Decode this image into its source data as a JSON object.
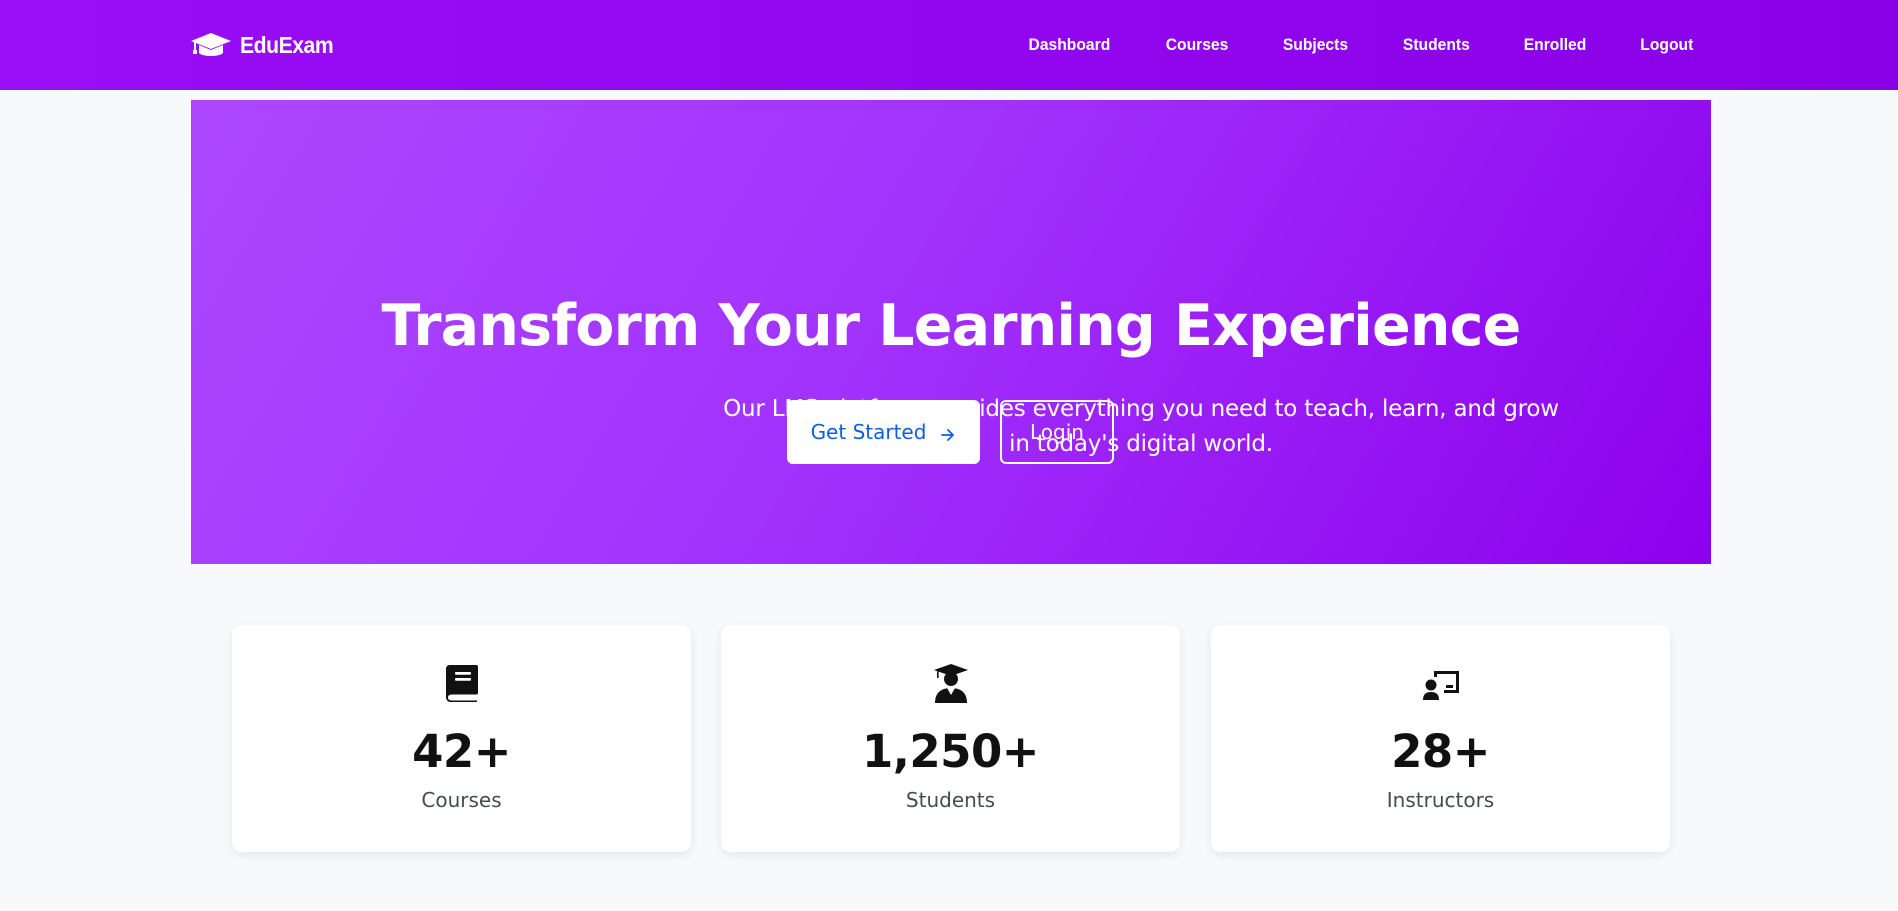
{
  "navbar": {
    "brand": "EduExam",
    "brand_icon": "graduation-cap-icon",
    "links": [
      {
        "label": "Dashboard"
      },
      {
        "label": "Courses"
      },
      {
        "label": "Subjects"
      },
      {
        "label": "Students"
      },
      {
        "label": "Enrolled"
      },
      {
        "label": "Logout"
      }
    ]
  },
  "hero": {
    "title": "Transform Your Learning Experience",
    "subtitle": "Our LMS platform provides everything you need to teach, learn, and grow in today's digital world.",
    "primary_button": {
      "label": "Get Started",
      "icon": "arrow-right-icon"
    },
    "secondary_button": {
      "label": "Login"
    }
  },
  "stats": [
    {
      "icon": "book-icon",
      "value": "42+",
      "label": "Courses"
    },
    {
      "icon": "user-graduate-icon",
      "value": "1,250+",
      "label": "Students"
    },
    {
      "icon": "chalkboard-teacher-icon",
      "value": "28+",
      "label": "Instructors"
    }
  ],
  "colors": {
    "nav_bg": "#9a0ef7",
    "hero_start": "#ac47ff",
    "hero_end": "#8d00ec",
    "primary_button_text": "#0d5ee8",
    "page_bg": "#f8f9fa"
  }
}
